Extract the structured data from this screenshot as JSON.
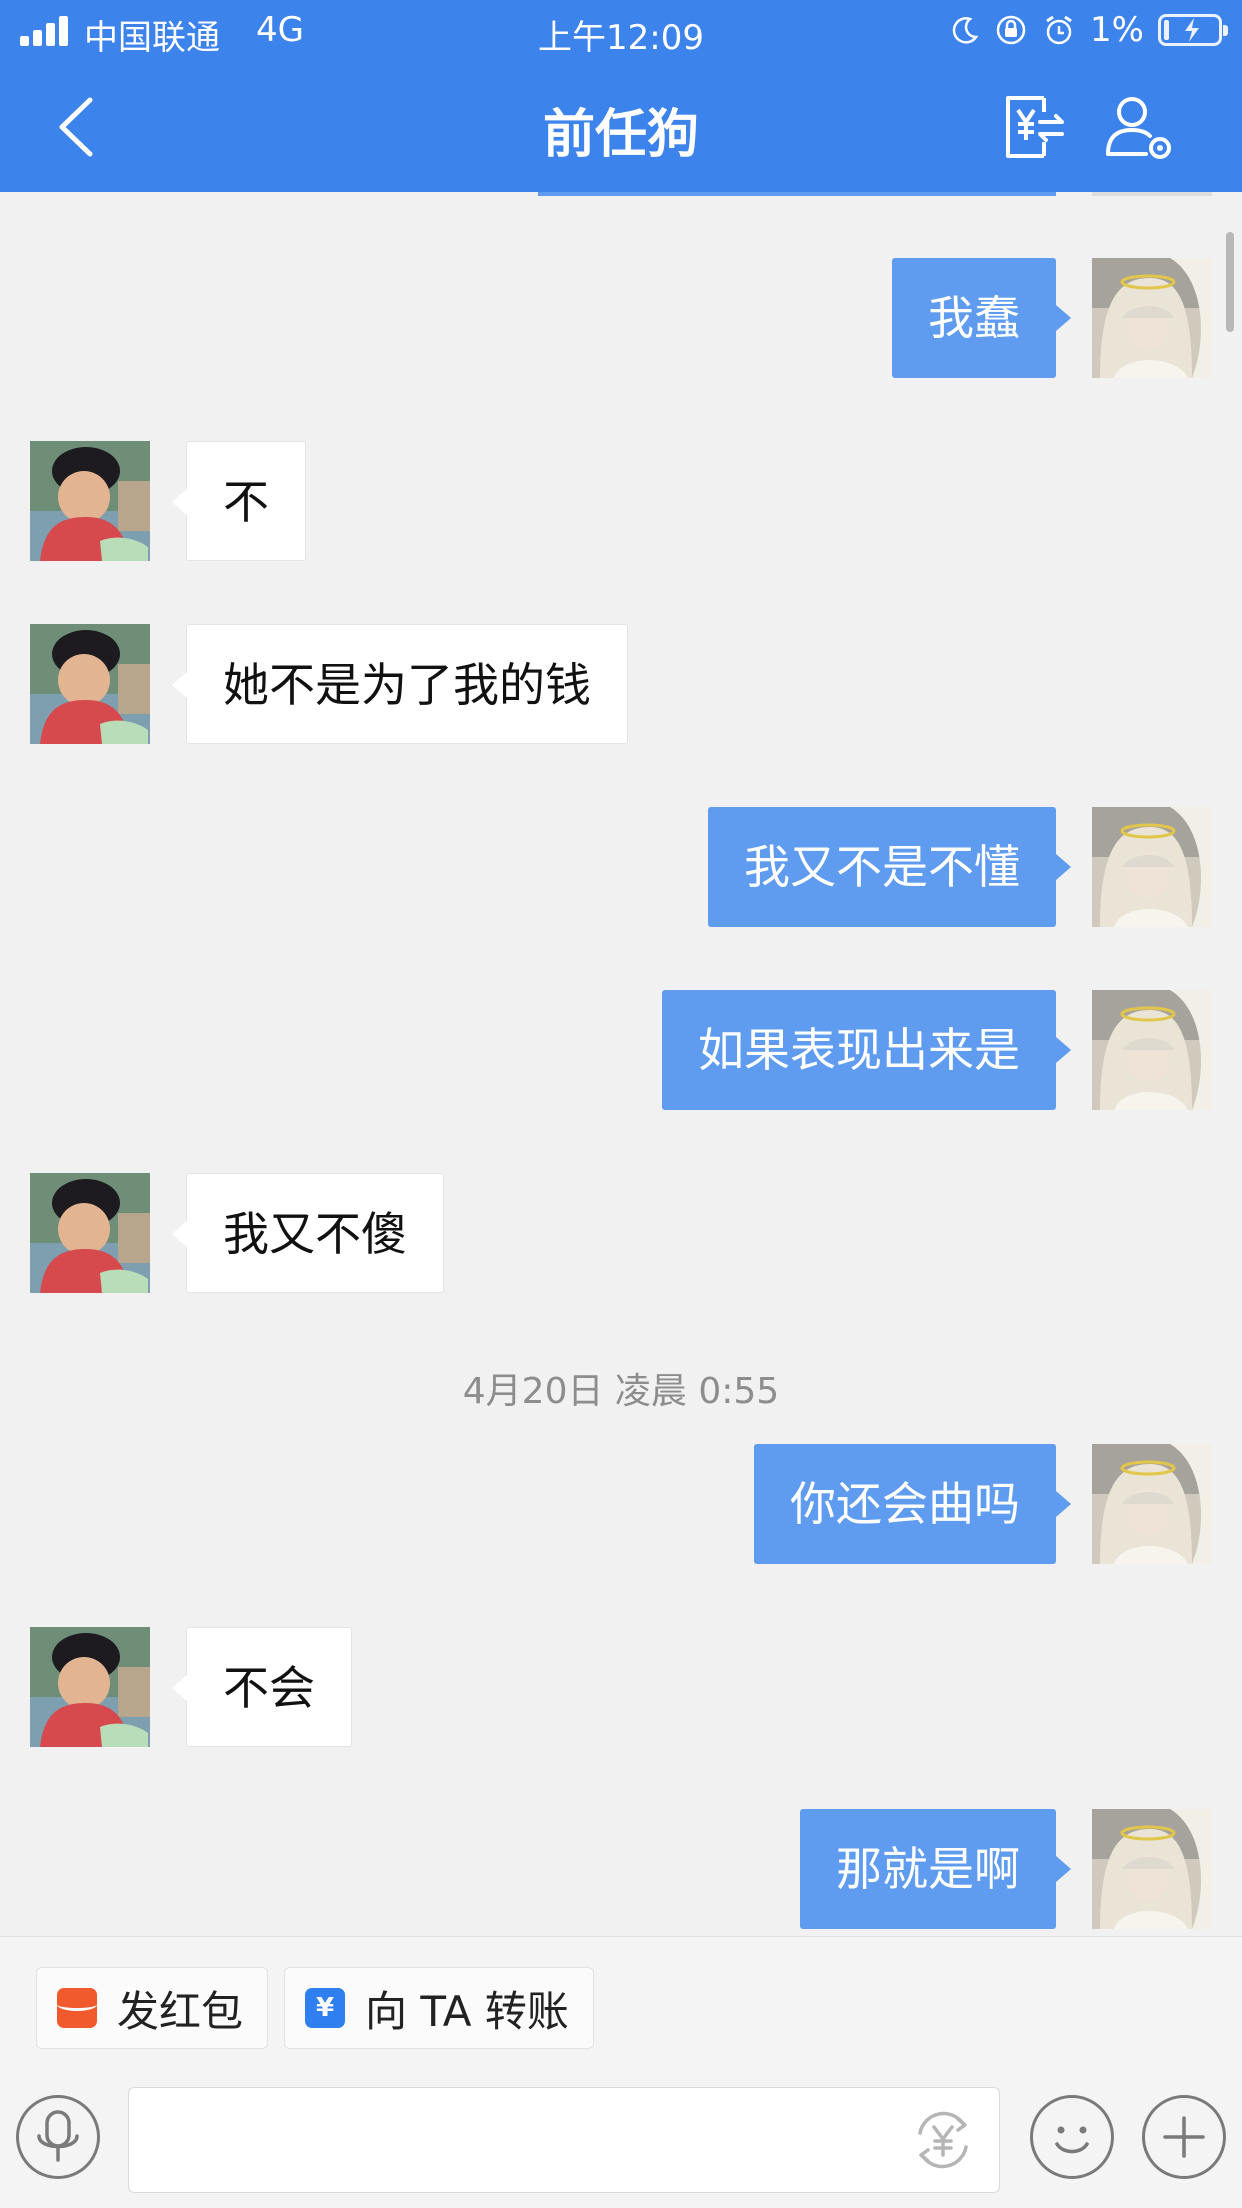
{
  "status_bar": {
    "carrier": "中国联通",
    "network": "4G",
    "time": "上午12:09",
    "battery": "1%"
  },
  "header": {
    "title": "前任狗",
    "back_icon": "chevron-left-icon",
    "right_icons": [
      "transfer-record-icon",
      "profile-settings-icon"
    ]
  },
  "messages": [
    {
      "side": "out",
      "text": "我蠢"
    },
    {
      "side": "in",
      "text": "不"
    },
    {
      "side": "in",
      "text": "她不是为了我的钱"
    },
    {
      "side": "out",
      "text": "我又不是不懂"
    },
    {
      "side": "out",
      "text": "如果表现出来是"
    },
    {
      "side": "in",
      "text": "我又不傻"
    },
    {
      "side": "out",
      "text": "你还会曲吗"
    },
    {
      "side": "in",
      "text": "不会"
    },
    {
      "side": "out",
      "text": "那就是啊"
    }
  ],
  "timestamp": "4月20日 凌晨 0:55",
  "quick_actions": {
    "red_packet": "发红包",
    "transfer": "向 TA 转账"
  },
  "input": {
    "value": "",
    "placeholder": ""
  },
  "colors": {
    "header": "#3d83ec",
    "outgoing_bubble": "#5f9cf0",
    "incoming_bubble": "#ffffff",
    "background": "#f1f1f1"
  }
}
